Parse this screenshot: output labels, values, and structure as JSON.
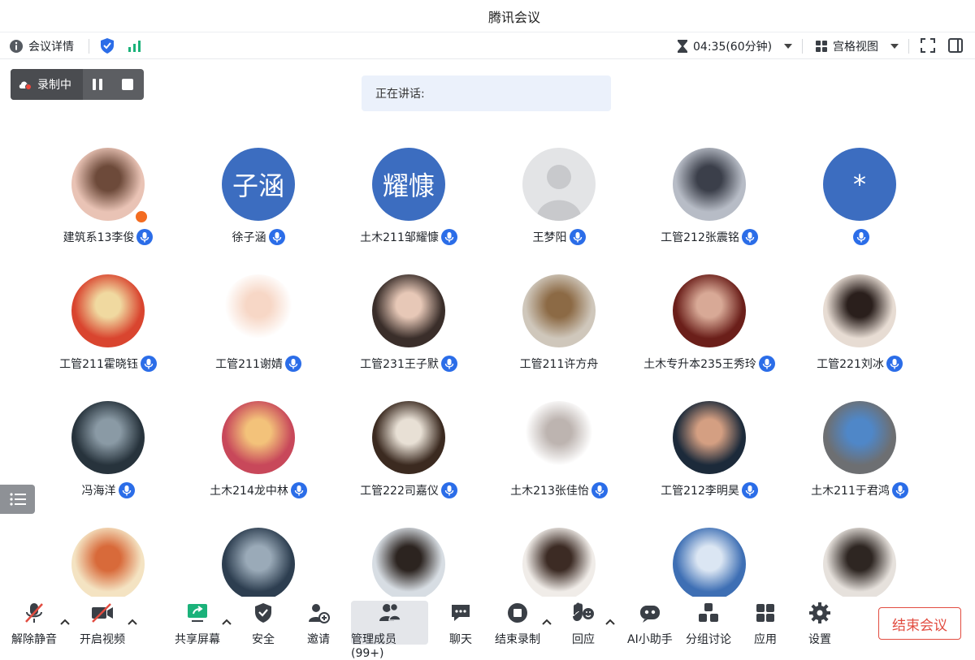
{
  "app": {
    "title": "腾讯会议"
  },
  "topbar": {
    "meeting_info": "会议详情",
    "timer": "04:35(60分钟)",
    "view_mode": "宫格视图"
  },
  "recording": {
    "status": "录制中"
  },
  "speaker": {
    "label": "正在讲话:"
  },
  "participants": [
    {
      "name": "建筑系13李俊",
      "avatar": "photo-girl-cap",
      "host": true
    },
    {
      "name": "徐子涵",
      "avatar_text": "子涵"
    },
    {
      "name": "土木211邹耀慷",
      "avatar_text": "耀慷"
    },
    {
      "name": "王梦阳",
      "avatar": "default-person"
    },
    {
      "name": "工管212张震铭",
      "avatar": "anime-boy"
    },
    {
      "name": "",
      "avatar_text": "*"
    },
    {
      "name": "工管211霍晓钰",
      "avatar": "photo-sunglasses"
    },
    {
      "name": "工管211谢婧",
      "avatar": "cartoon-character"
    },
    {
      "name": "工管231王子默",
      "avatar": "photo-girl-portrait"
    },
    {
      "name": "工管211许方舟",
      "avatar": "photo-dog",
      "mic": false
    },
    {
      "name": "土木专升本235王秀玲",
      "avatar": "photo-girl-red"
    },
    {
      "name": "工管221刘冰",
      "avatar": "photo-girl-bedroom"
    },
    {
      "name": "冯海洋",
      "avatar": "photo-landscape"
    },
    {
      "name": "土木214龙中林",
      "avatar": "illustration-bike"
    },
    {
      "name": "工管222司嘉仪",
      "avatar": "photo-child-cat"
    },
    {
      "name": "土木213张佳怡",
      "avatar": "sketch-bear"
    },
    {
      "name": "工管212李明昊",
      "avatar": "photo-man-suit"
    },
    {
      "name": "土木211于君鸿",
      "avatar": "illustration-sleeping"
    },
    {
      "name": "",
      "avatar": "anime-character"
    },
    {
      "name": "",
      "avatar": "photo-dark-sky"
    },
    {
      "name": "",
      "avatar": "photo-woman-sunglasses"
    },
    {
      "name": "",
      "avatar": "photo-two-girls"
    },
    {
      "name": "",
      "avatar": "photo-blue-sky"
    },
    {
      "name": "",
      "avatar": "photo-boy"
    }
  ],
  "toolbar": {
    "unmute": "解除静音",
    "start_video": "开启视频",
    "share_screen": "共享屏幕",
    "security": "安全",
    "invite": "邀请",
    "manage_members": "管理成员(99+)",
    "chat": "聊天",
    "stop_recording": "结束录制",
    "react": "回应",
    "ai_assistant": "AI小助手",
    "breakout": "分组讨论",
    "apps": "应用",
    "settings": "设置",
    "end_meeting": "结束会议"
  },
  "colors": {
    "accent": "#2b6de8",
    "avatar_blue": "#3c6dc0",
    "end_red": "#e24c40",
    "share_green": "#1bb27a"
  }
}
